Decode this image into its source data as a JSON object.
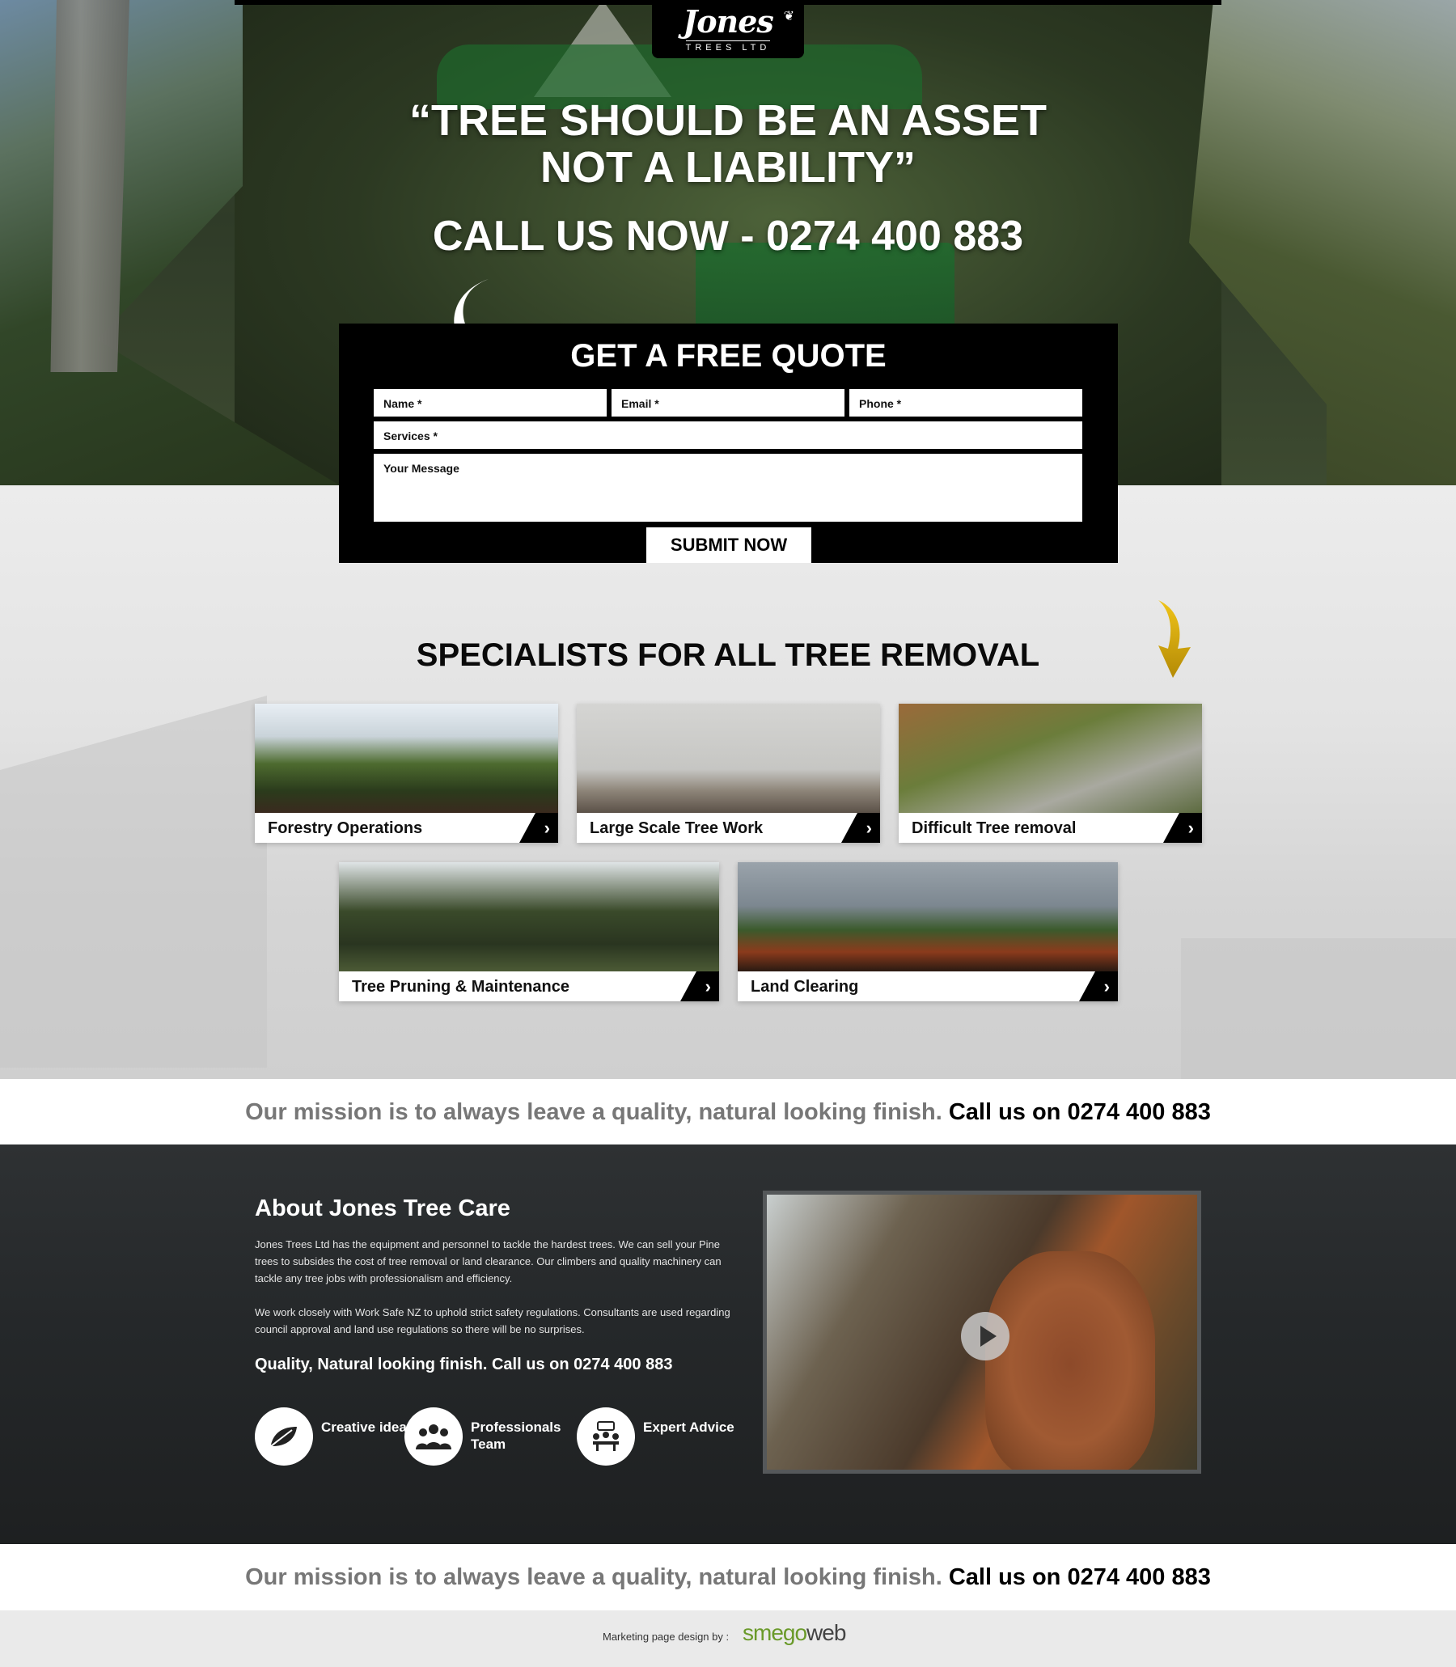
{
  "logo": {
    "name": "Jones",
    "sub": "TREES LTD"
  },
  "hero": {
    "quote_line1": "“TREE SHOULD BE AN ASSET",
    "quote_line2": "NOT A LIABILITY”",
    "call": "CALL US NOW - 0274 400 883"
  },
  "quote_form": {
    "title": "GET A FREE QUOTE",
    "name_placeholder": "Name *",
    "email_placeholder": "Email *",
    "phone_placeholder": "Phone *",
    "services_placeholder": "Services *",
    "message_placeholder": "Your Message",
    "submit_label": "SUBMIT NOW"
  },
  "specialists": {
    "title": "SPECIALISTS FOR ALL TREE REMOVAL",
    "cards": [
      {
        "label": "Forestry Operations"
      },
      {
        "label": "Large Scale Tree Work"
      },
      {
        "label": "Difficult Tree removal"
      },
      {
        "label": "Tree Pruning & Maintenance"
      },
      {
        "label": "Land Clearing"
      }
    ]
  },
  "mission": {
    "text": "Our mission is to always leave a quality, natural looking finish.",
    "call": "Call us on 0274 400 883"
  },
  "about": {
    "title": "About Jones Tree Care",
    "paragraph1": "Jones Trees Ltd has the equipment and personnel to tackle the hardest trees. We can sell your Pine trees to subsides the cost of tree removal or land clearance. Our climbers and quality machinery can tackle any tree jobs with professionalism and efficiency.",
    "paragraph2": "We work closely with Work Safe NZ to uphold strict safety regulations. Consultants are used regarding council approval and land use regulations so there will be no surprises.",
    "cta": "Quality, Natural looking finish. Call us on 0274 400 883",
    "features": [
      {
        "icon": "leaf-icon",
        "label": "Creative ideas"
      },
      {
        "icon": "team-icon",
        "label": "Professionals Team"
      },
      {
        "icon": "advice-icon",
        "label": "Expert Advice"
      }
    ]
  },
  "footer": {
    "text": "Marketing page design by :",
    "brand_sme": "smego",
    "brand_web": "web"
  }
}
